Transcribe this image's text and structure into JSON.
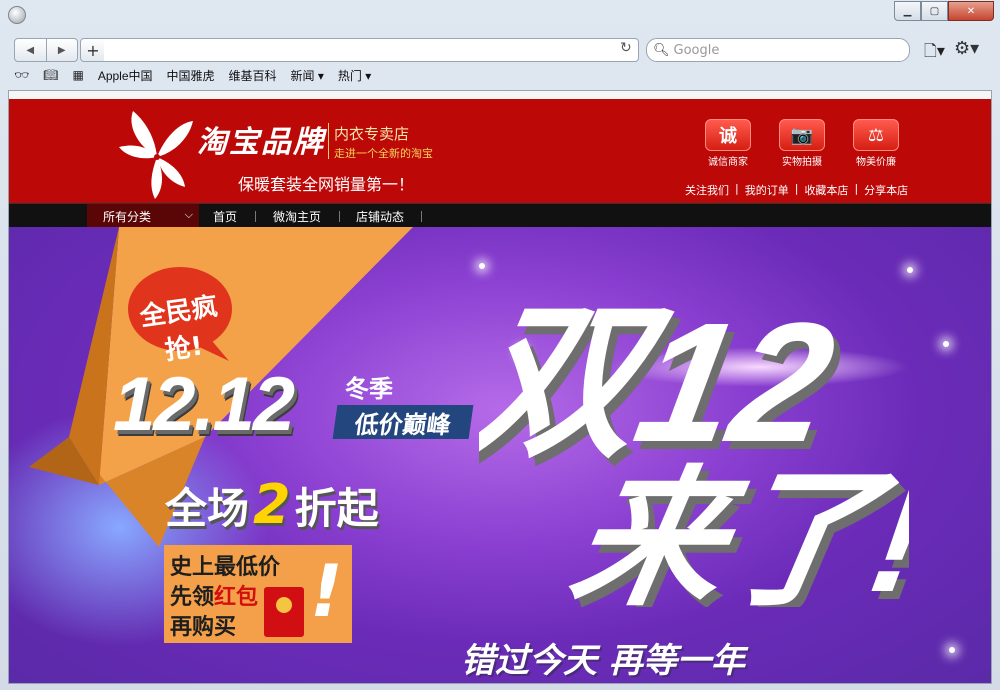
{
  "browser": {
    "url": "",
    "search_placeholder": "Google",
    "bookmarks": [
      "Apple中国",
      "中国雅虎",
      "维基百科",
      "新闻 ▾",
      "热门 ▾"
    ]
  },
  "shop": {
    "logo_text": "淘宝品牌",
    "logo_sub1": "内衣专卖店",
    "logo_sub2": "走进一个全新的淘宝",
    "slogan": "保暖套装全网销量第一！",
    "badges": [
      {
        "glyph": "诚",
        "label": "诚信商家"
      },
      {
        "glyph": "📷",
        "label": "实物拍摄"
      },
      {
        "glyph": "⚖",
        "label": "物美价廉"
      }
    ],
    "toplinks": [
      "关注我们",
      "我的订单",
      "收藏本店",
      "分享本店"
    ]
  },
  "nav": {
    "all_categories": "所有分类",
    "items": [
      "首页",
      "微淘主页",
      "店铺动态"
    ]
  },
  "banner": {
    "bubble": "全民疯抢!",
    "date": "12.12",
    "season": "冬季",
    "tag": "低价巅峰",
    "sale_pre": "全场",
    "sale_num": "2",
    "sale_post": "折起",
    "promo_l1": "史上最低价",
    "promo_l2a": "先领",
    "promo_l2b": "红包",
    "promo_l3": "再购买",
    "big_title_l1": "双12",
    "big_title_l2": "来了!",
    "bottom": "错过今天  再等一年"
  }
}
